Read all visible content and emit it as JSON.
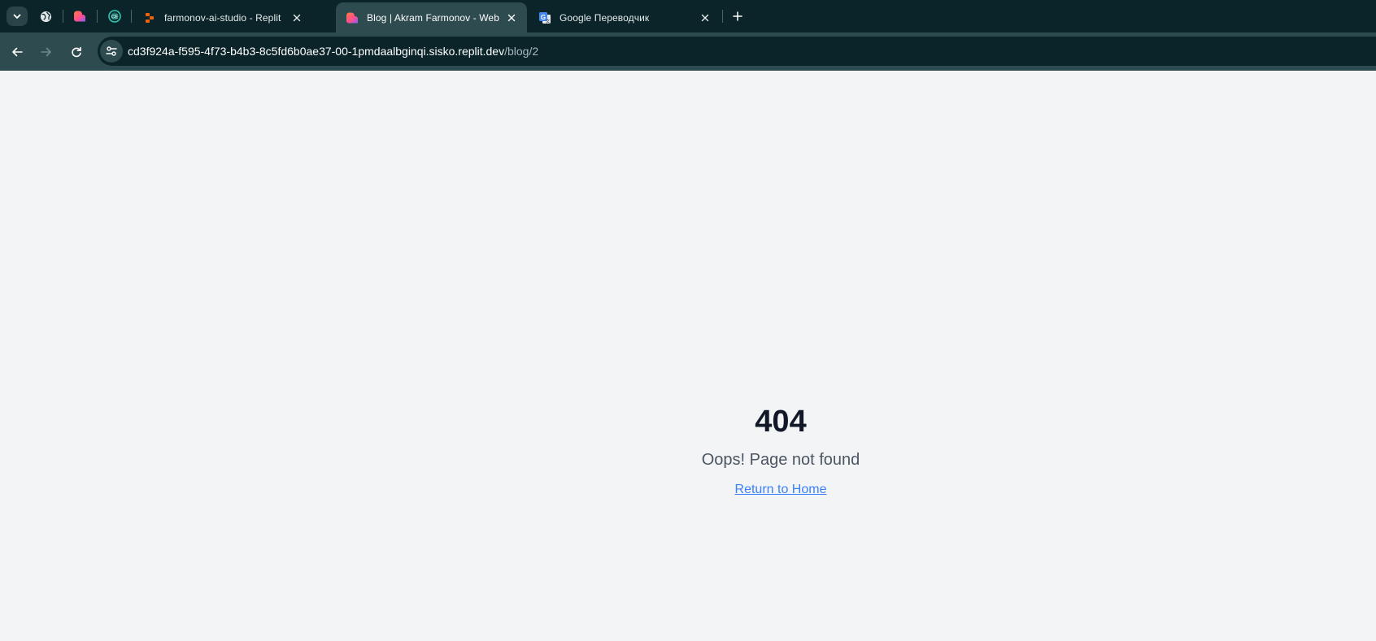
{
  "browser": {
    "tabs": [
      {
        "title": "farmonov-ai-studio - Replit",
        "icon": "replit-icon",
        "active": false
      },
      {
        "title": "Blog | Akram Farmonov - Web D",
        "icon": "lovable-heart-icon",
        "active": true
      },
      {
        "title": "Google Переводчик",
        "icon": "google-translate-icon",
        "active": false
      }
    ],
    "url": {
      "host": "cd3f924a-f595-4f73-b4b3-8c5fd6b0ae37-00-1pmdaalbginqi.sisko.replit.dev",
      "path": "/blog/2"
    },
    "colors": {
      "tabbar": "#0b2429",
      "toolbar": "#2e4b50",
      "replit_orange": "#f26207"
    }
  },
  "page": {
    "code": "404",
    "message": "Oops! Page not found",
    "link_label": "Return to Home",
    "colors": {
      "background": "#f3f4f6",
      "heading": "#111827",
      "message": "#4b5563",
      "link": "#3b82f6"
    }
  }
}
